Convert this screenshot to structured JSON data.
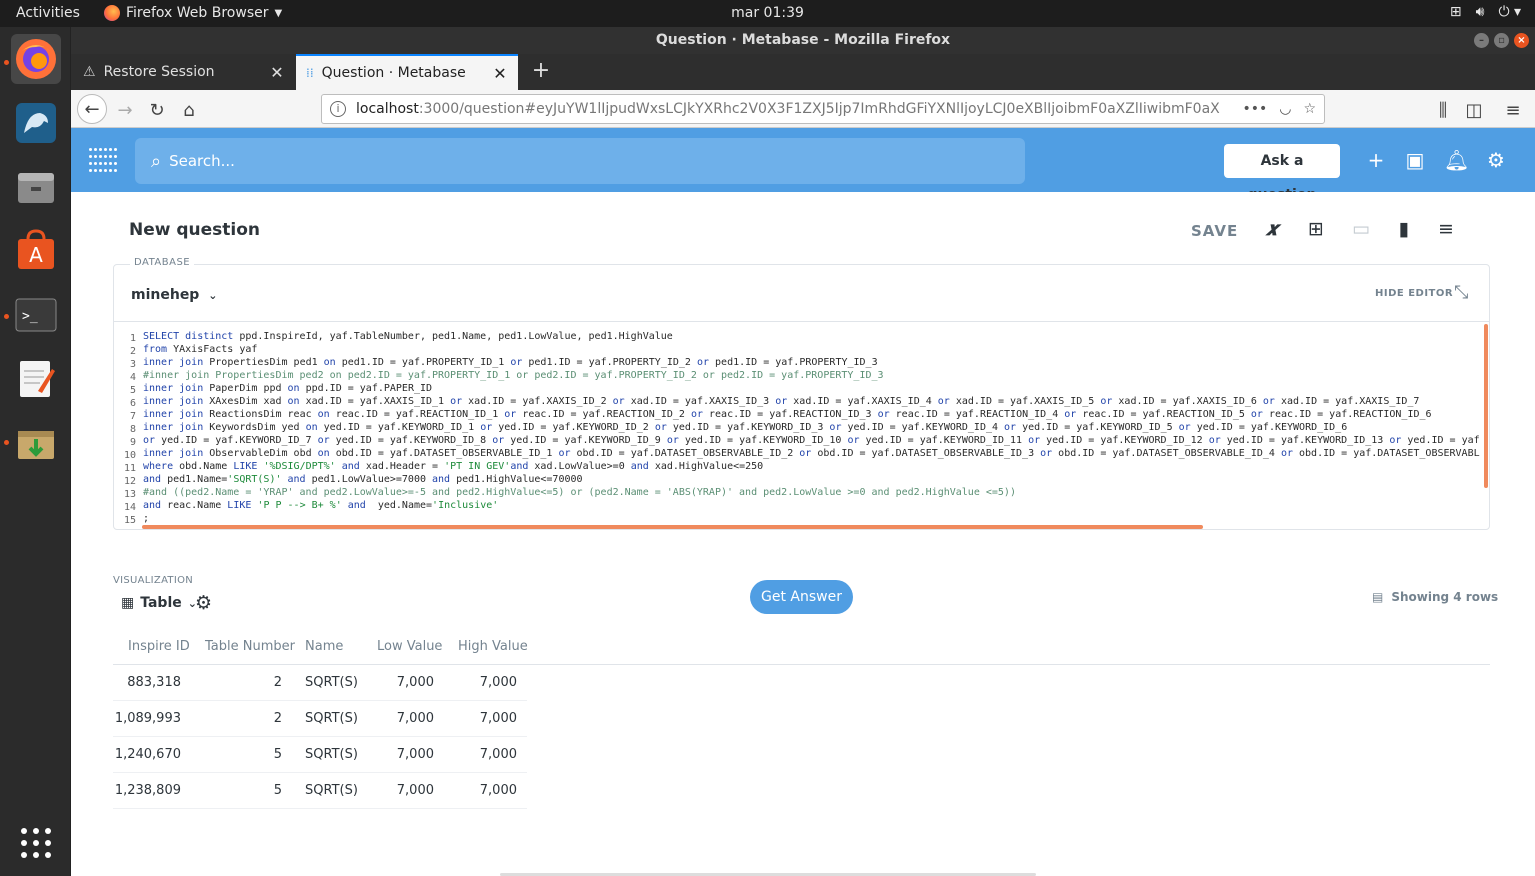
{
  "topbar": {
    "activities": "Activities",
    "app_name": "Firefox Web Browser",
    "clock": "mar 01:39"
  },
  "window": {
    "title": "Question · Metabase - Mozilla Firefox"
  },
  "tabs": [
    {
      "label": "Restore Session"
    },
    {
      "label": "Question · Metabase"
    }
  ],
  "urlbar": {
    "host": "localhost",
    "rest": ":3000/question#eyJuYW1lIjpudWxsLCJkYXRhc2V0X3F1ZXJ5Ijp7ImRhdGFiYXNlIjoyLCJ0eXBlIjoibmF0aXZlIiwibmF0aX"
  },
  "metabase": {
    "search_placeholder": "Search...",
    "ask_question": "Ask a question"
  },
  "question": {
    "title": "New question",
    "save_label": "SAVE",
    "database_label": "DATABASE",
    "database": "minehep",
    "hide_editor": "HIDE EDITOR",
    "visualization_label": "VISUALIZATION",
    "viz_type": "Table",
    "get_answer": "Get Answer",
    "row_count": "Showing 4 rows"
  },
  "sql_lines": [
    "SELECT distinct ppd.InspireId, yaf.TableNumber, ped1.Name, ped1.LowValue, ped1.HighValue",
    "from YAxisFacts yaf",
    "inner join PropertiesDim ped1 on ped1.ID = yaf.PROPERTY_ID_1 or ped1.ID = yaf.PROPERTY_ID_2 or ped1.ID = yaf.PROPERTY_ID_3",
    "#inner join PropertiesDim ped2 on ped2.ID = yaf.PROPERTY_ID_1 or ped2.ID = yaf.PROPERTY_ID_2 or ped2.ID = yaf.PROPERTY_ID_3",
    "inner join PaperDim ppd on ppd.ID = yaf.PAPER_ID",
    "inner join XAxesDim xad on xad.ID = yaf.XAXIS_ID_1 or xad.ID = yaf.XAXIS_ID_2 or xad.ID = yaf.XAXIS_ID_3 or xad.ID = yaf.XAXIS_ID_4 or xad.ID = yaf.XAXIS_ID_5 or xad.ID = yaf.XAXIS_ID_6 or xad.ID = yaf.XAXIS_ID_7",
    "inner join ReactionsDim reac on reac.ID = yaf.REACTION_ID_1 or reac.ID = yaf.REACTION_ID_2 or reac.ID = yaf.REACTION_ID_3 or reac.ID = yaf.REACTION_ID_4 or reac.ID = yaf.REACTION_ID_5 or reac.ID = yaf.REACTION_ID_6",
    "inner join KeywordsDim yed on yed.ID = yaf.KEYWORD_ID_1 or yed.ID = yaf.KEYWORD_ID_2 or yed.ID = yaf.KEYWORD_ID_3 or yed.ID = yaf.KEYWORD_ID_4 or yed.ID = yaf.KEYWORD_ID_5 or yed.ID = yaf.KEYWORD_ID_6",
    "or yed.ID = yaf.KEYWORD_ID_7 or yed.ID = yaf.KEYWORD_ID_8 or yed.ID = yaf.KEYWORD_ID_9 or yed.ID = yaf.KEYWORD_ID_10 or yed.ID = yaf.KEYWORD_ID_11 or yed.ID = yaf.KEYWORD_ID_12 or yed.ID = yaf.KEYWORD_ID_13 or yed.ID = yaf.",
    "inner join ObservableDim obd on obd.ID = yaf.DATASET_OBSERVABLE_ID_1 or obd.ID = yaf.DATASET_OBSERVABLE_ID_2 or obd.ID = yaf.DATASET_OBSERVABLE_ID_3 or obd.ID = yaf.DATASET_OBSERVABLE_ID_4 or obd.ID = yaf.DATASET_OBSERVABLE",
    "where obd.Name LIKE '%DSIG/DPT%' and xad.Header = 'PT IN GEV'and xad.LowValue>=0 and xad.HighValue<=250",
    "and ped1.Name='SQRT(S)' and ped1.LowValue>=7000 and ped1.HighValue<=70000",
    "#and ((ped2.Name = 'YRAP' and ped2.LowValue>=-5 and ped2.HighValue<=5) or (ped2.Name = 'ABS(YRAP)' and ped2.LowValue >=0 and ped2.HighValue <=5))",
    "and reac.Name LIKE 'P P --> B+ %' and  yed.Name='Inclusive'",
    ";"
  ],
  "table": {
    "columns": [
      "Inspire ID",
      "Table Number",
      "Name",
      "Low Value",
      "High Value"
    ],
    "rows": [
      [
        "883,318",
        "2",
        "SQRT(S)",
        "7,000",
        "7,000"
      ],
      [
        "1,089,993",
        "2",
        "SQRT(S)",
        "7,000",
        "7,000"
      ],
      [
        "1,240,670",
        "5",
        "SQRT(S)",
        "7,000",
        "7,000"
      ],
      [
        "1,238,809",
        "5",
        "SQRT(S)",
        "7,000",
        "7,000"
      ]
    ]
  },
  "colors": {
    "metabase_blue": "#509ee3",
    "editor_accent": "#f08a5d",
    "ubuntu_orange": "#e95420"
  },
  "icons": {
    "dock": [
      "firefox-icon",
      "mysql-workbench-icon",
      "file-manager-icon",
      "software-center-icon",
      "terminal-icon",
      "text-editor-icon",
      "archive-manager-icon",
      "app-grid-icon"
    ]
  }
}
